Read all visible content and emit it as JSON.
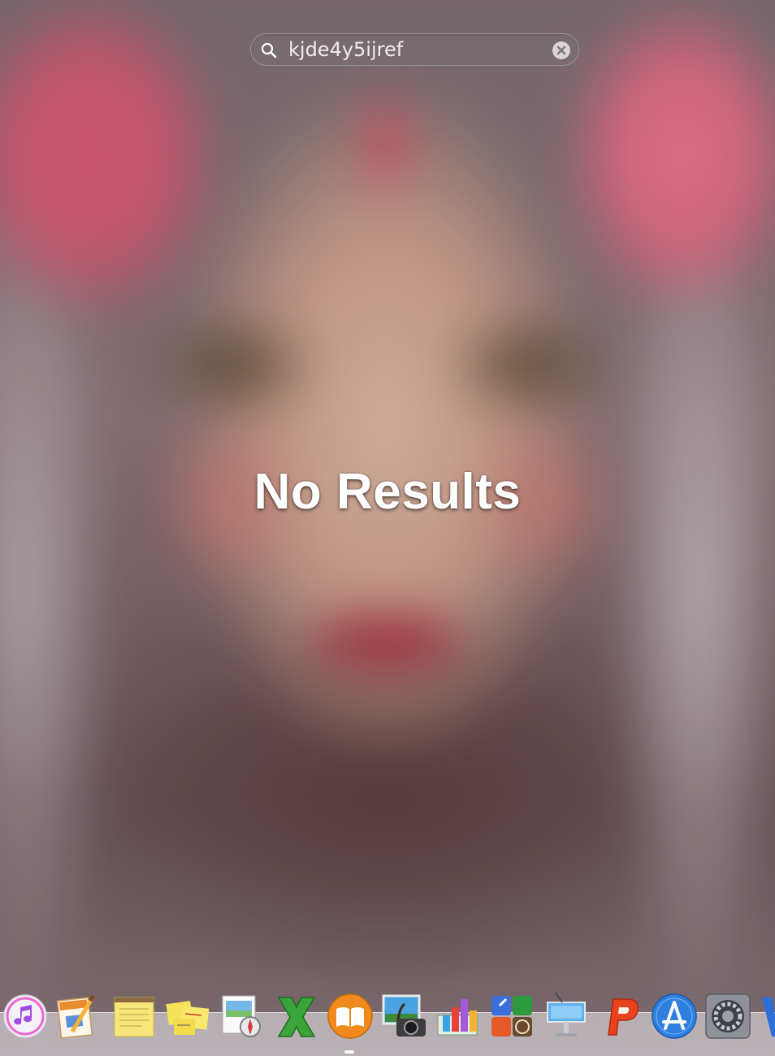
{
  "search": {
    "value": "kjde4y5ijref",
    "placeholder": ""
  },
  "main": {
    "message": "No Results"
  },
  "dock": {
    "items": [
      {
        "icon": "itunes-icon"
      },
      {
        "icon": "pages-icon"
      },
      {
        "icon": "notes-icon"
      },
      {
        "icon": "stickies-icon"
      },
      {
        "icon": "preview-icon"
      },
      {
        "icon": "excel-icon"
      },
      {
        "icon": "ibooks-icon"
      },
      {
        "icon": "image-capture-icon"
      },
      {
        "icon": "numbers-icon"
      },
      {
        "icon": "dashboard-icon"
      },
      {
        "icon": "keynote-icon"
      },
      {
        "icon": "powerpoint-icon"
      },
      {
        "icon": "app-store-icon"
      },
      {
        "icon": "system-preferences-icon"
      },
      {
        "icon": "word-icon"
      }
    ]
  },
  "colors": {
    "search_text": "#f0ecee",
    "message_text": "#ffffff"
  }
}
